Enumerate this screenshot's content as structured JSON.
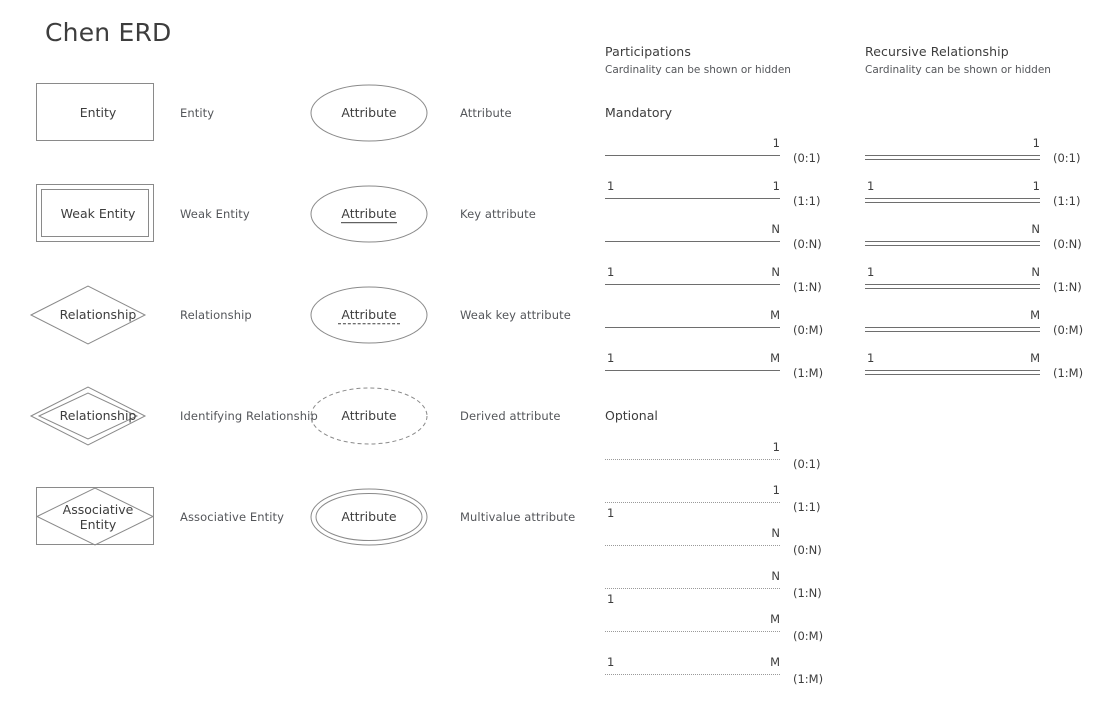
{
  "title": "Chen ERD",
  "legend": {
    "entities": [
      {
        "shape": "rectangle",
        "shape_text": "Entity",
        "label": "Entity"
      },
      {
        "shape": "double-rectangle",
        "shape_text": "Weak Entity",
        "label": "Weak Entity"
      },
      {
        "shape": "diamond",
        "shape_text": "Relationship",
        "label": "Relationship"
      },
      {
        "shape": "double-diamond",
        "shape_text": "Relationship",
        "label": "Identifying Relationship"
      },
      {
        "shape": "rectangle-diamond",
        "shape_text": "Associative\nEntity",
        "label": "Associative Entity"
      }
    ],
    "attributes": [
      {
        "shape": "ellipse",
        "shape_text": "Attribute",
        "underline": "none",
        "label": "Attribute"
      },
      {
        "shape": "ellipse",
        "shape_text": "Attribute",
        "underline": "solid",
        "label": "Key attribute"
      },
      {
        "shape": "ellipse",
        "shape_text": "Attribute",
        "underline": "dashed",
        "label": "Weak key attribute"
      },
      {
        "shape": "dashed-ellipse",
        "shape_text": "Attribute",
        "underline": "none",
        "label": "Derived attribute"
      },
      {
        "shape": "double-ellipse",
        "shape_text": "Attribute",
        "underline": "none",
        "label": "Multivalue attribute"
      }
    ]
  },
  "participations": {
    "heading": "Participations",
    "subheading": "Cardinality can be shown or hidden",
    "mandatory_heading": "Mandatory",
    "optional_heading": "Optional",
    "mandatory": [
      {
        "left": "",
        "right": "1",
        "cardinality": "(0:1)"
      },
      {
        "left": "1",
        "right": "1",
        "cardinality": "(1:1)"
      },
      {
        "left": "",
        "right": "N",
        "cardinality": "(0:N)"
      },
      {
        "left": "1",
        "right": "N",
        "cardinality": "(1:N)"
      },
      {
        "left": "",
        "right": "M",
        "cardinality": "(0:M)"
      },
      {
        "left": "1",
        "right": "M",
        "cardinality": "(1:M)"
      }
    ],
    "optional": [
      {
        "left": "",
        "right": "1",
        "cardinality": "(0:1)",
        "left_below": false
      },
      {
        "left": "1",
        "right": "1",
        "cardinality": "(1:1)",
        "left_below": true
      },
      {
        "left": "",
        "right": "N",
        "cardinality": "(0:N)",
        "left_below": false
      },
      {
        "left": "1",
        "right": "N",
        "cardinality": "(1:N)",
        "left_below": true
      },
      {
        "left": "",
        "right": "M",
        "cardinality": "(0:M)",
        "left_below": false
      },
      {
        "left": "1",
        "right": "M",
        "cardinality": "(1:M)",
        "left_below": false
      }
    ]
  },
  "recursive": {
    "heading": "Recursive Relationship",
    "subheading": "Cardinality can be shown or hidden",
    "rows": [
      {
        "left": "",
        "right": "1",
        "cardinality": "(0:1)"
      },
      {
        "left": "1",
        "right": "1",
        "cardinality": "(1:1)"
      },
      {
        "left": "",
        "right": "N",
        "cardinality": "(0:N)"
      },
      {
        "left": "1",
        "right": "N",
        "cardinality": "(1:N)"
      },
      {
        "left": "",
        "right": "M",
        "cardinality": "(0:M)"
      },
      {
        "left": "1",
        "right": "M",
        "cardinality": "(1:M)"
      }
    ]
  },
  "colors": {
    "shape_stroke": "#8a8a8a",
    "line_stroke": "#6e6e6e",
    "dotted_stroke": "#9a9a9a",
    "text": "#3d3d3d",
    "label_text": "#54565a",
    "background": "#ffffff"
  }
}
